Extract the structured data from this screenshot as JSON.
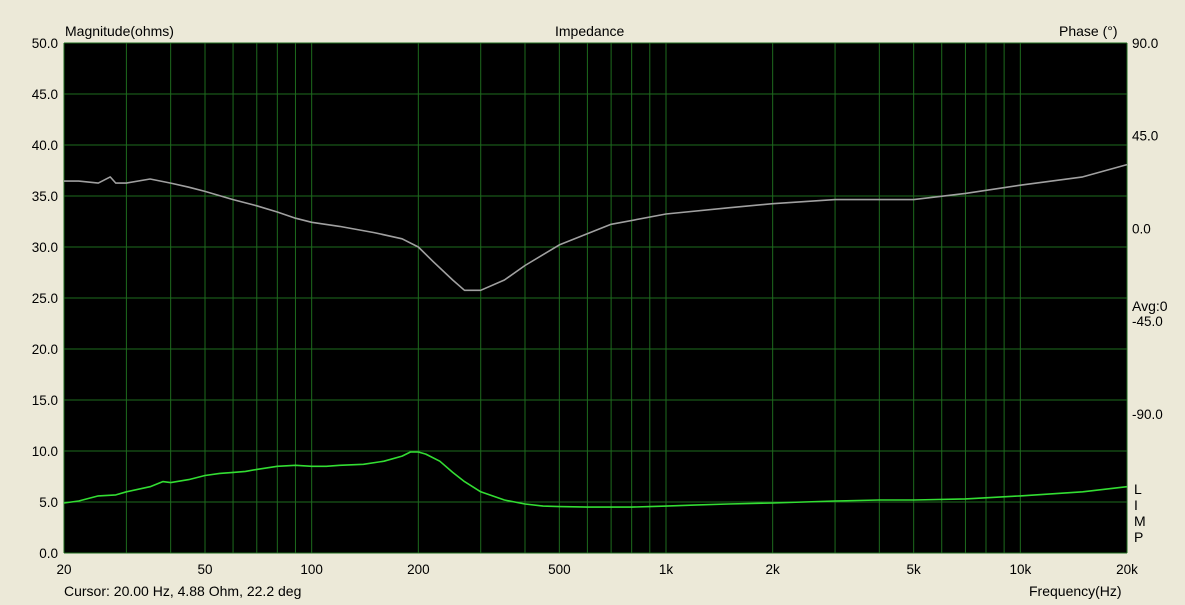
{
  "header": {
    "left_axis_title": "Magnitude(ohms)",
    "center_title": "Impedance",
    "right_axis_title": "Phase (°)"
  },
  "side_panel": {
    "avg_label": "Avg:0",
    "mode_letters": [
      "L",
      "I",
      "M",
      "P"
    ]
  },
  "footer": {
    "cursor_readout": "Cursor: 20.00 Hz, 4.88 Ohm, 22.2 deg",
    "x_axis_title": "Frequency(Hz)"
  },
  "colors": {
    "plot_background": "#000000",
    "window_background": "#ece9d8",
    "grid": "#1e6b1e",
    "magnitude_trace": "#33dd33",
    "phase_trace": "#a0a0a0"
  },
  "chart_data": {
    "type": "line",
    "title": "Impedance",
    "xlabel": "Frequency(Hz)",
    "ylabel": "Magnitude(ohms)",
    "y2label": "Phase (°)",
    "xscale": "log",
    "xlim": [
      20,
      20000
    ],
    "ylim": [
      0,
      50
    ],
    "y2lim": [
      -157.5,
      90
    ],
    "grid": true,
    "x_ticks": [
      20,
      50,
      100,
      200,
      500,
      1000,
      2000,
      5000,
      10000,
      20000
    ],
    "x_tick_labels": [
      "20",
      "50",
      "100",
      "200",
      "500",
      "1k",
      "2k",
      "5k",
      "10k",
      "20k"
    ],
    "x_minor_grid": [
      30,
      40,
      60,
      70,
      80,
      90,
      300,
      400,
      600,
      700,
      800,
      900,
      3000,
      4000,
      6000,
      7000,
      8000,
      9000
    ],
    "y_ticks": [
      0,
      5,
      10,
      15,
      20,
      25,
      30,
      35,
      40,
      45,
      50
    ],
    "y_tick_labels": [
      "0.0",
      "5.0",
      "10.0",
      "15.0",
      "20.0",
      "25.0",
      "30.0",
      "35.0",
      "40.0",
      "45.0",
      "50.0"
    ],
    "y2_ticks": [
      90,
      45,
      0,
      -45,
      -90
    ],
    "y2_tick_labels": [
      "90.0",
      "45.0",
      "0.0",
      "-45.0",
      "-90.0"
    ],
    "series": [
      {
        "axis": "left",
        "color": "#33dd33",
        "x": [
          20,
          22,
          25,
          28,
          30,
          35,
          38,
          40,
          45,
          50,
          55,
          60,
          65,
          70,
          80,
          90,
          100,
          110,
          120,
          140,
          160,
          180,
          190,
          200,
          210,
          230,
          250,
          270,
          300,
          350,
          400,
          450,
          500,
          600,
          700,
          800,
          900,
          1000,
          1200,
          1500,
          2000,
          3000,
          4000,
          5000,
          7000,
          10000,
          15000,
          20000
        ],
        "y": [
          4.9,
          5.1,
          5.6,
          5.7,
          6.0,
          6.5,
          7.0,
          6.9,
          7.2,
          7.6,
          7.8,
          7.9,
          8.0,
          8.2,
          8.5,
          8.6,
          8.5,
          8.5,
          8.6,
          8.7,
          9.0,
          9.5,
          9.9,
          9.9,
          9.7,
          9.0,
          7.9,
          7.0,
          6.0,
          5.2,
          4.8,
          4.6,
          4.55,
          4.5,
          4.5,
          4.5,
          4.55,
          4.6,
          4.7,
          4.8,
          4.9,
          5.1,
          5.2,
          5.2,
          5.3,
          5.6,
          6.0,
          6.5
        ]
      },
      {
        "axis": "right",
        "color": "#a0a0a0",
        "x": [
          20,
          22,
          25,
          27,
          28,
          30,
          35,
          40,
          45,
          50,
          60,
          70,
          80,
          90,
          100,
          120,
          150,
          180,
          200,
          220,
          250,
          270,
          300,
          350,
          400,
          500,
          700,
          1000,
          1500,
          2000,
          3000,
          5000,
          7000,
          10000,
          15000,
          20000
        ],
        "y": [
          23,
          23,
          22,
          25,
          22,
          22,
          24,
          22,
          20,
          18,
          14,
          11,
          8,
          5,
          3,
          1,
          -2,
          -5,
          -9,
          -16,
          -25,
          -30,
          -30,
          -25,
          -18,
          -8,
          2,
          7,
          10,
          12,
          14,
          14,
          17,
          21,
          25,
          31
        ]
      }
    ]
  }
}
